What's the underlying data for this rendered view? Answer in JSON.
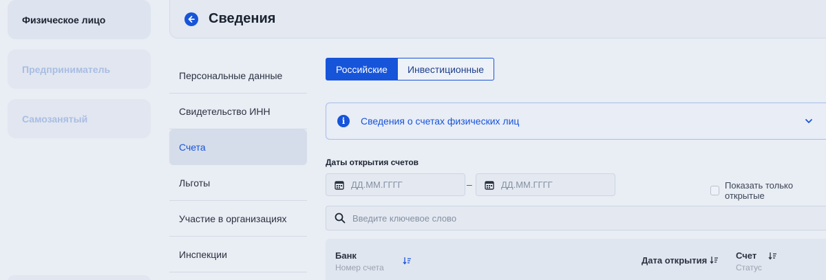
{
  "roles": [
    {
      "label": "Физическое лицо",
      "active": true
    },
    {
      "label": "Предприниматель",
      "active": false
    },
    {
      "label": "Самозанятый",
      "active": false
    }
  ],
  "header": {
    "title": "Сведения"
  },
  "nav": {
    "items": [
      {
        "label": "Персональные данные"
      },
      {
        "label": "Свидетельство ИНН"
      },
      {
        "label": "Счета"
      },
      {
        "label": "Льготы"
      },
      {
        "label": "Участие в организациях"
      },
      {
        "label": "Инспекции"
      }
    ],
    "active_index": 2
  },
  "tabs": [
    {
      "label": "Российские"
    },
    {
      "label": "Инвестиционные"
    }
  ],
  "info": {
    "text": "Сведения о счетах физических лиц"
  },
  "dates": {
    "label": "Даты открытия счетов",
    "from_placeholder": "ДД.ММ.ГГГГ",
    "to_placeholder": "ДД.ММ.ГГГГ",
    "separator": "–"
  },
  "only_open": {
    "label": "Показать только открытые"
  },
  "search": {
    "placeholder": "Введите ключевое слово"
  },
  "table": {
    "columns": [
      {
        "title": "Банк",
        "subtitle": "Номер счета"
      },
      {
        "title": "Дата открытия",
        "subtitle": ""
      },
      {
        "title": "Счет",
        "subtitle": "Статус"
      }
    ]
  },
  "colors": {
    "accent": "#1654d9",
    "background": "#e9edf4"
  }
}
